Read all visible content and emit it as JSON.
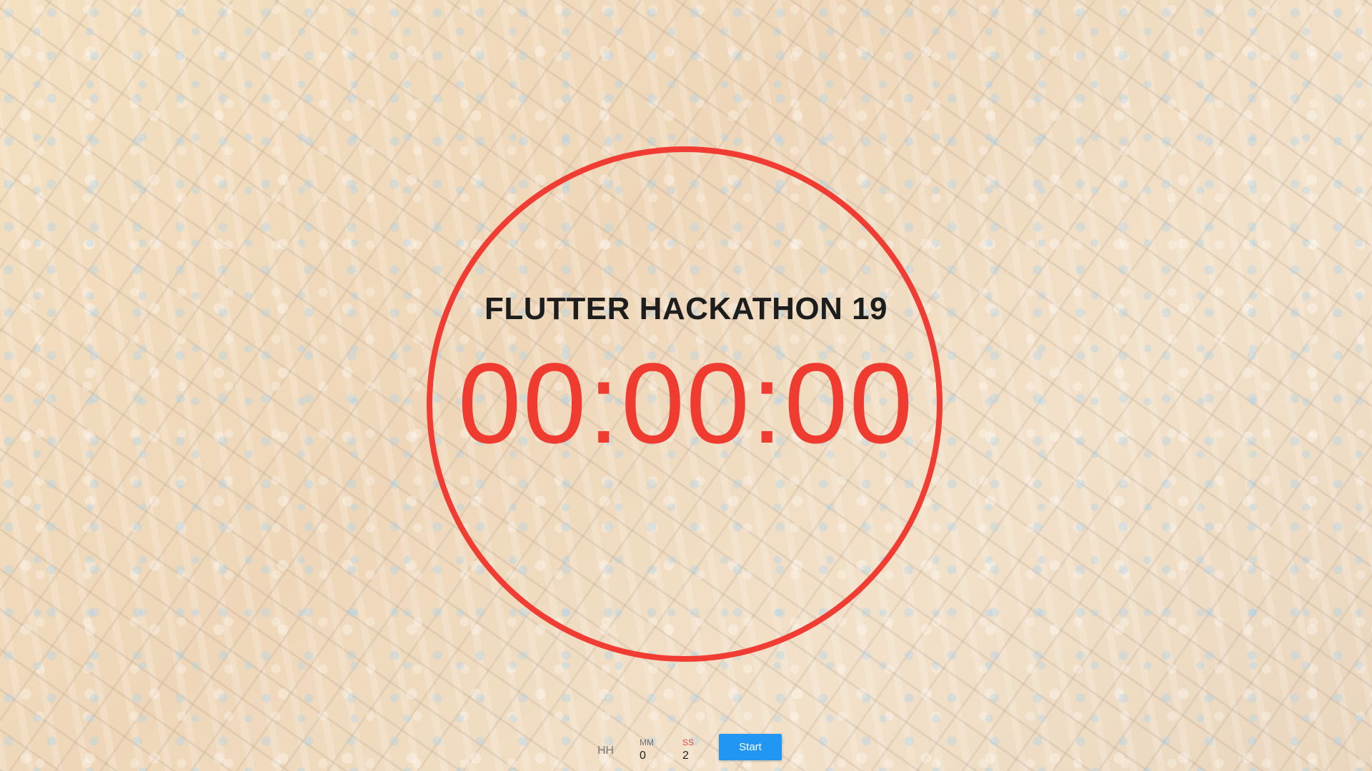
{
  "app": {
    "title": "FLUTTER HACKATHON 19",
    "timer_display": "00:00:00",
    "accent_color": "#f03c32",
    "button_color": "#2196f3",
    "background": "aerial-city-photo"
  },
  "controls": {
    "hours": {
      "label": "HH",
      "value": ""
    },
    "minutes": {
      "label": "MM",
      "value": "0"
    },
    "seconds": {
      "label": "SS",
      "value": "2"
    },
    "start_label": "Start"
  }
}
